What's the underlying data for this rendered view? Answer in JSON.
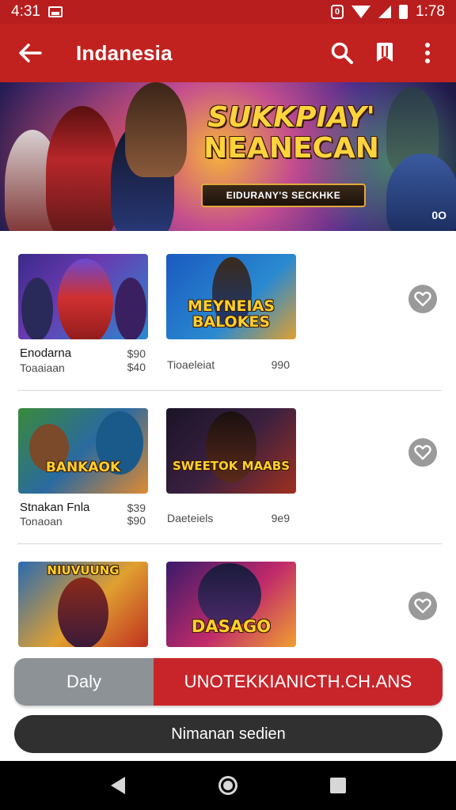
{
  "status_bar": {
    "time_left": "4:31",
    "time_right": "1:78",
    "alert_glyph": "0"
  },
  "app_bar": {
    "title": "Indanesia",
    "icons": [
      "back-arrow-icon",
      "search-icon",
      "bookmark-icon",
      "more-vert-icon"
    ]
  },
  "hero": {
    "headline_line1": "SUKKPIAY'",
    "headline_line2": "NEANECAN",
    "ribbon": "EIDURANY'S SECKHKE",
    "corner": "0O",
    "colors": {
      "headline": "#ffd33c",
      "ribbon_border": "#e2a93a"
    }
  },
  "games": {
    "rows": [
      {
        "left": {
          "art_title": "",
          "name": "Enodarna",
          "sub": "Toaaiaan",
          "price1": "$90",
          "price2": "$40"
        },
        "right": {
          "art_title": "MEYNEIAS BALOKES",
          "sub": "Tioaeleiat",
          "price": "990"
        }
      },
      {
        "left": {
          "art_title": "BANKAOK",
          "name": "Stnakan Fnla",
          "sub": "Tonaoan",
          "price1": "$39",
          "price2": "$90"
        },
        "right": {
          "art_title": "SWEETOK MAABS",
          "sub": "Daeteiels",
          "price": "9e9"
        }
      },
      {
        "left": {
          "art_title": "NIUVUUNG",
          "name": "",
          "sub": "",
          "price1": "",
          "price2": ""
        },
        "right": {
          "art_title": "DASAGO",
          "sub": "",
          "price": ""
        }
      }
    ]
  },
  "controls": {
    "daily_label": "Daly",
    "main_label": "UNOTEKKIANICTH.CH.ANS",
    "secondary_label": "Nimanan sedien"
  },
  "colors": {
    "primary": "#c1221f",
    "status_bar": "#b81e1e",
    "segment_gray": "#8d9297",
    "pill_dark": "#303030"
  }
}
